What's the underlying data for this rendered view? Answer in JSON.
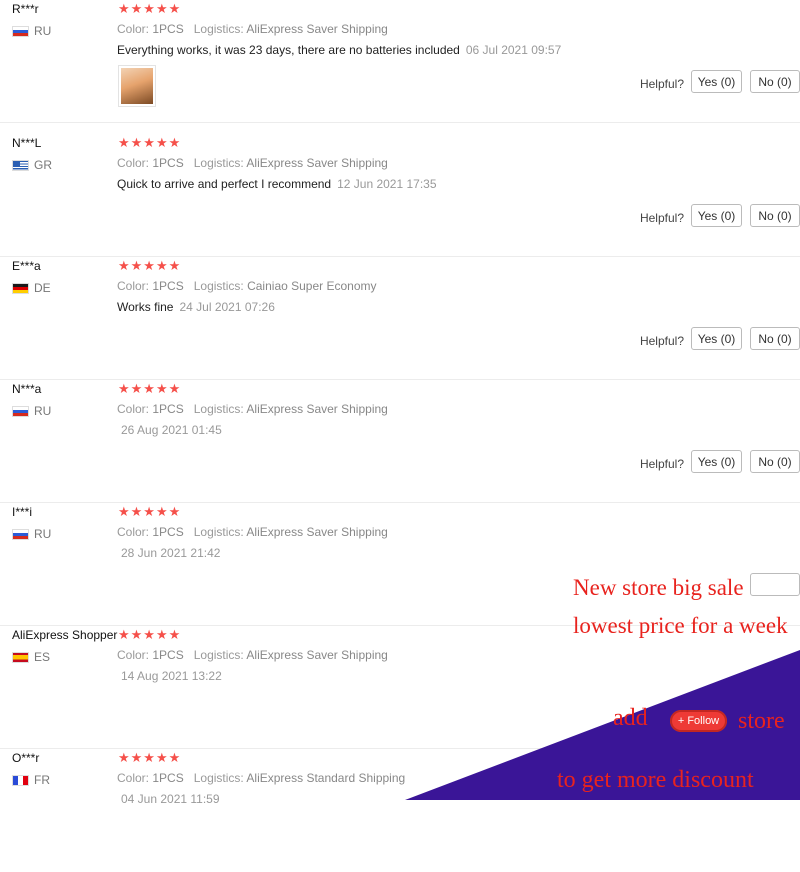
{
  "labels": {
    "color": "Color:",
    "logistics": "Logistics:",
    "helpful": "Helpful?"
  },
  "stars": "★★★★★",
  "reviews": [
    {
      "user": "R***r",
      "country": "RU",
      "color_value": "1PCS",
      "logistics_value": "AliExpress Saver Shipping",
      "text": "Everything works, it was 23 days, there are no batteries included",
      "date": "06 Jul 2021 09:57",
      "yes": "Yes (0)",
      "no": "No (0)"
    },
    {
      "user": "N***L",
      "country": "GR",
      "color_value": "1PCS",
      "logistics_value": "AliExpress Saver Shipping",
      "text": "Quick to arrive and perfect I recommend",
      "date": "12 Jun 2021 17:35",
      "yes": "Yes (0)",
      "no": "No (0)"
    },
    {
      "user": "E***a",
      "country": "DE",
      "color_value": "1PCS",
      "logistics_value": "Cainiao Super Economy",
      "text": "Works fine",
      "date": "24 Jul 2021 07:26",
      "yes": "Yes (0)",
      "no": "No (0)"
    },
    {
      "user": "N***a",
      "country": "RU",
      "color_value": "1PCS",
      "logistics_value": "AliExpress Saver Shipping",
      "text": "",
      "date": "26 Aug 2021 01:45",
      "yes": "Yes (0)",
      "no": "No (0)"
    },
    {
      "user": "I***i",
      "country": "RU",
      "color_value": "1PCS",
      "logistics_value": "AliExpress Saver Shipping",
      "text": "",
      "date": "28 Jun 2021 21:42"
    },
    {
      "user": "AliExpress Shopper",
      "country": "ES",
      "color_value": "1PCS",
      "logistics_value": "AliExpress Saver Shipping",
      "text": "",
      "date": "14 Aug 2021 13:22"
    },
    {
      "user": "O***r",
      "country": "FR",
      "color_value": "1PCS",
      "logistics_value": "AliExpress Standard Shipping",
      "text": "",
      "date": "04 Jun 2021 11:59"
    }
  ],
  "promo": {
    "line1": "New store big sale",
    "line2": "lowest price for a week",
    "add": "add",
    "follow": "+ Follow",
    "store": "store",
    "line4": "to get more discount",
    "bg_color": "#3a1597",
    "text_color": "#e8231e"
  }
}
